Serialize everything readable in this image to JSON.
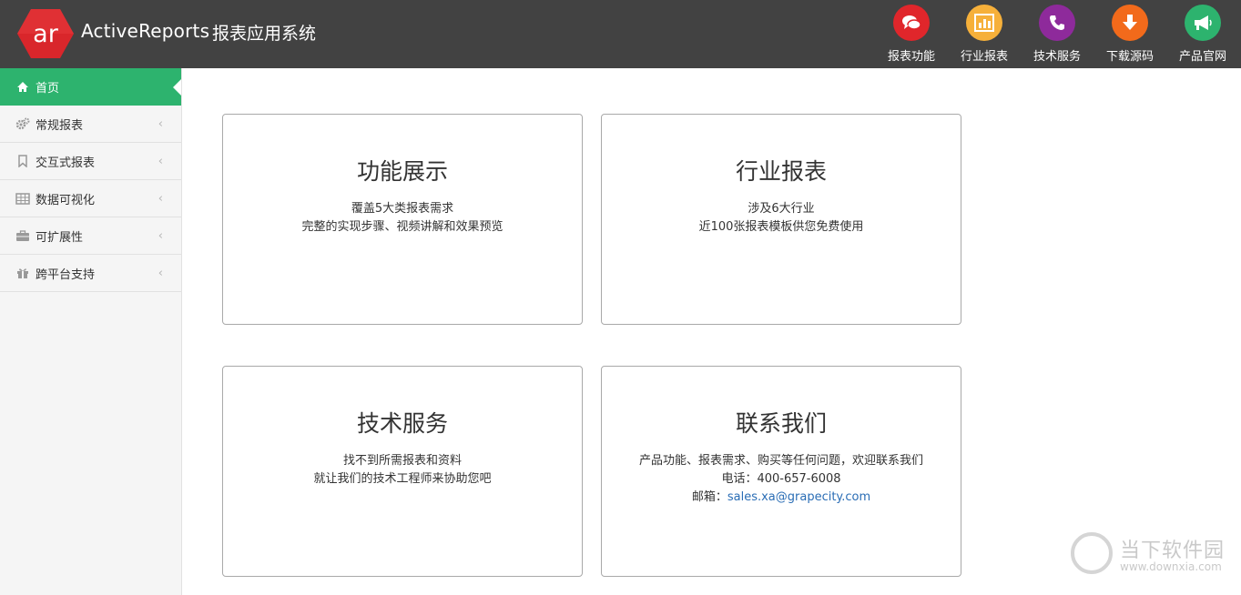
{
  "header": {
    "logo_text": "ar",
    "app_name": "ActiveReports",
    "app_subtitle": "报表应用系统",
    "nav": [
      {
        "label": "报表功能",
        "icon": "chat-bubbles-icon",
        "color": "#e0262b"
      },
      {
        "label": "行业报表",
        "icon": "bar-chart-icon",
        "color": "#f6b03a"
      },
      {
        "label": "技术服务",
        "icon": "phone-icon",
        "color": "#8e2a9b"
      },
      {
        "label": "下载源码",
        "icon": "download-arrow-icon",
        "color": "#f26a1b"
      },
      {
        "label": "产品官网",
        "icon": "megaphone-icon",
        "color": "#2db36e"
      }
    ]
  },
  "sidebar": {
    "items": [
      {
        "label": "首页",
        "icon": "home-icon"
      },
      {
        "label": "常规报表",
        "icon": "gears-icon"
      },
      {
        "label": "交互式报表",
        "icon": "bookmark-icon"
      },
      {
        "label": "数据可视化",
        "icon": "table-icon"
      },
      {
        "label": "可扩展性",
        "icon": "briefcase-icon"
      },
      {
        "label": "跨平台支持",
        "icon": "gift-icon"
      }
    ],
    "active_color": "#2db36e"
  },
  "cards": [
    {
      "title": "功能展示",
      "lines": [
        "覆盖5大类报表需求",
        "完整的实现步骤、视频讲解和效果预览"
      ]
    },
    {
      "title": "行业报表",
      "lines": [
        "涉及6大行业",
        "近100张报表模板供您免费使用"
      ]
    },
    {
      "title": "技术服务",
      "lines": [
        "找不到所需报表和资料",
        "就让我们的技术工程师来协助您吧"
      ]
    },
    {
      "title": "联系我们",
      "lines": [
        "产品功能、报表需求、购买等任何问题，欢迎联系我们",
        "电话：400-657-6008"
      ],
      "email_label": "邮箱：",
      "email": "sales.xa@grapecity.com"
    }
  ],
  "watermark": {
    "title": "当下软件园",
    "url": "www.downxia.com"
  }
}
